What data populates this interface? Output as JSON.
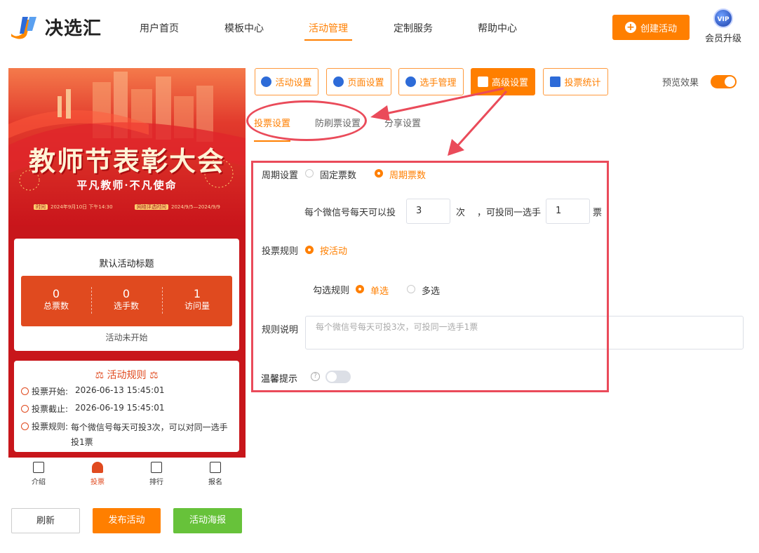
{
  "brand": {
    "name": "决选汇"
  },
  "nav": {
    "items": [
      "用户首页",
      "模板中心",
      "活动管理",
      "定制服务",
      "帮助中心"
    ],
    "active": "活动管理"
  },
  "header": {
    "create_label": "创建活动",
    "vip_badge": "VIP",
    "vip_label": "会员升级"
  },
  "colors": {
    "accent": "#ff7f00",
    "highlight": "#ea4b5a",
    "success": "#67c23a",
    "banner_red": "#c8161b"
  },
  "preview": {
    "banner": {
      "title": "教师节表彰大会",
      "subtitle": "平凡教师·不凡使命",
      "meta_left_tag": "时间",
      "meta_left": "2024年9月10日 下午14:30",
      "meta_right_tag": "网络评选时间",
      "meta_right": "2024/9/5—2024/9/9"
    },
    "card_title": "默认活动标题",
    "stats": [
      {
        "value": "0",
        "label": "总票数"
      },
      {
        "value": "0",
        "label": "选手数"
      },
      {
        "value": "1",
        "label": "访问量"
      }
    ],
    "status": "活动未开始",
    "rules": {
      "title": "活动规则",
      "start_label": "投票开始:",
      "start_value": "2026-06-13 15:45:01",
      "end_label": "投票截止:",
      "end_value": "2026-06-19 15:45:01",
      "rule_label": "投票规则:",
      "rule_value_line1": "每个微信号每天可投3次，可以对同一选手",
      "rule_value_line2": "投1票"
    },
    "tabbar": [
      "介绍",
      "投票",
      "排行",
      "报名"
    ],
    "tabbar_active": "投票"
  },
  "actions": {
    "refresh": "刷新",
    "publish": "发布活动",
    "poster": "活动海报"
  },
  "toolbar": {
    "tools": [
      {
        "label": "活动设置",
        "icon": "star-icon"
      },
      {
        "label": "页面设置",
        "icon": "gear-icon"
      },
      {
        "label": "选手管理",
        "icon": "users-icon"
      },
      {
        "label": "高级设置",
        "icon": "sliders-icon"
      },
      {
        "label": "投票统计",
        "icon": "bar-chart-icon"
      }
    ],
    "active": "高级设置",
    "preview_label": "预览效果",
    "preview_on": true
  },
  "subtabs": {
    "items": [
      "投票设置",
      "防刷票设置",
      "分享设置"
    ],
    "active": "投票设置"
  },
  "form": {
    "period_label": "周期设置",
    "period_options": [
      "固定票数",
      "周期票数"
    ],
    "period_selected": "周期票数",
    "daily_label": "每个微信号每天可以投",
    "daily_value": "3",
    "daily_unit": "次",
    "same_label": "，可投同一选手",
    "same_value": "1",
    "same_unit": "票",
    "rule_label": "投票规则",
    "rule_option": "按活动",
    "check_label": "勾选规则",
    "check_options": [
      "单选",
      "多选"
    ],
    "check_selected": "单选",
    "desc_label": "规则说明",
    "desc_placeholder": "每个微信号每天可投3次，可投同一选手1票",
    "tip_label": "温馨提示",
    "tip_on": false
  }
}
